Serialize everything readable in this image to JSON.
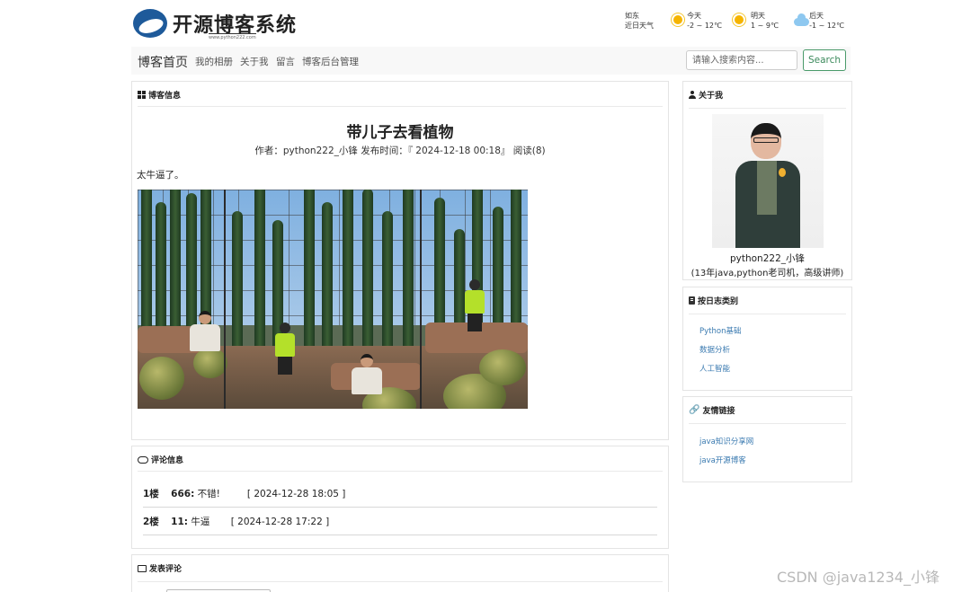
{
  "site": {
    "logo_title": "开源博客系统",
    "logo_url": "www.python222.com"
  },
  "weather": {
    "location": "如东",
    "subtitle": "近日天气",
    "days": [
      {
        "label": "今天",
        "temp": "-2 ~ 12℃",
        "icon": "sun-icon"
      },
      {
        "label": "明天",
        "temp": "1 ~ 9℃",
        "icon": "sun-icon"
      },
      {
        "label": "后天",
        "temp": "-1 ~ 12℃",
        "icon": "cloud-icon"
      }
    ]
  },
  "nav": {
    "brand": "博客首页",
    "links": [
      "我的相册",
      "关于我",
      "留言",
      "博客后台管理"
    ],
    "search_placeholder": "请输入搜索内容...",
    "search_button": "Search"
  },
  "blog_panel": {
    "heading": "博客信息",
    "title": "带儿子去看植物",
    "meta": "作者：python222_小锋    发布时间：『 2024-12-18 00:18』   阅读(8)",
    "body": "太牛逼了。"
  },
  "comments_panel": {
    "heading": "评论信息",
    "comments": [
      {
        "floor": "1楼",
        "user": "666:",
        "text": "不错!",
        "time": "[ 2024-12-28 18:05 ]"
      },
      {
        "floor": "2楼",
        "user": "11:",
        "text": "牛逼",
        "time": "[ 2024-12-28 17:22 ]"
      }
    ]
  },
  "post_comment_panel": {
    "heading": "发表评论"
  },
  "about_panel": {
    "heading": "关于我",
    "name": "python222_小锋",
    "description": "(13年java,python老司机，高级讲师)"
  },
  "category_panel": {
    "heading": "按日志类别",
    "items": [
      "Python基础",
      "数据分析",
      "人工智能"
    ]
  },
  "links_panel": {
    "heading": "友情链接",
    "items": [
      "java知识分享网",
      "java开源博客"
    ]
  },
  "watermark": "CSDN @java1234_小锋",
  "colors": {
    "link": "#3a7ab0",
    "search_button_border": "#4a9a6a",
    "nav_background": "#f8f8f8"
  }
}
